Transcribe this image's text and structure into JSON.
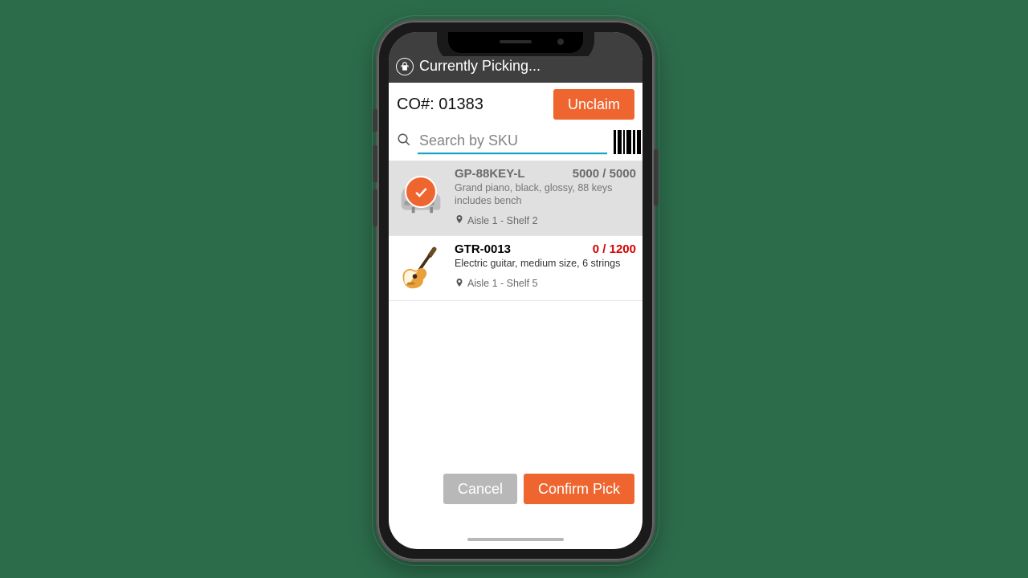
{
  "header": {
    "title": "Currently Picking..."
  },
  "order": {
    "co_label": "CO#: 01383",
    "unclaim_label": "Unclaim"
  },
  "search": {
    "placeholder": "Search by SKU",
    "value": ""
  },
  "items": [
    {
      "sku": "GP-88KEY-L",
      "qty_label": "5000 / 5000",
      "qty_state": "complete",
      "description": "Grand piano, black, glossy, 88 keys includes bench",
      "location": "Aisle 1 - Shelf 2",
      "icon": "piano",
      "checked": true
    },
    {
      "sku": "GTR-0013",
      "qty_label": "0 / 1200",
      "qty_state": "need",
      "description": "Electric guitar, medium size, 6 strings",
      "location": "Aisle 1 - Shelf 5",
      "icon": "guitar",
      "checked": false
    }
  ],
  "footer": {
    "cancel_label": "Cancel",
    "confirm_label": "Confirm Pick"
  },
  "colors": {
    "accent": "#ef6530",
    "danger_text": "#d60000"
  }
}
